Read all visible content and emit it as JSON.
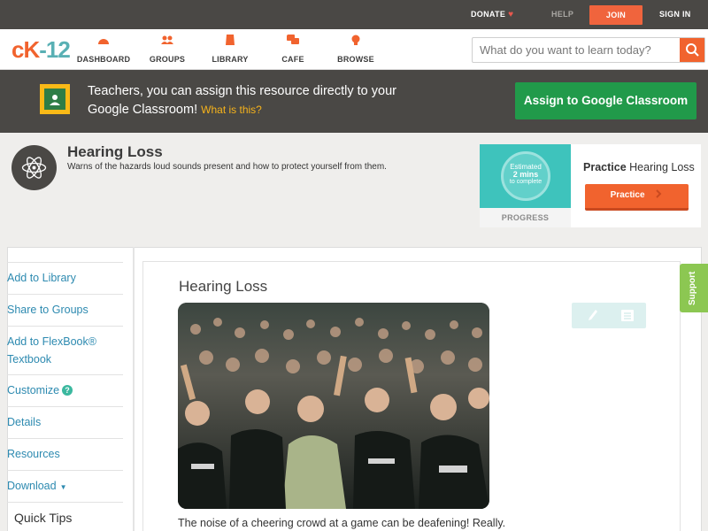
{
  "topbar": {
    "donate": "DONATE",
    "help": "HELP",
    "join": "JOIN",
    "signin": "SIGN IN"
  },
  "nav": {
    "logo": "CK-12",
    "items": [
      {
        "label": "DASHBOARD",
        "icon": "dashboard-icon"
      },
      {
        "label": "GROUPS",
        "icon": "groups-icon"
      },
      {
        "label": "LIBRARY",
        "icon": "library-icon"
      },
      {
        "label": "CAFE",
        "icon": "cafe-icon"
      },
      {
        "label": "BROWSE",
        "icon": "browse-icon"
      }
    ],
    "search_placeholder": "What do you want to learn today?"
  },
  "banner": {
    "text": "Teachers, you can assign this resource directly to your Google Classroom!",
    "link": "What is this?",
    "button": "Assign to Google Classroom"
  },
  "header": {
    "title": "Hearing Loss",
    "subtitle": "Warns of the hazards loud sounds present and how to protect yourself from them."
  },
  "practice": {
    "estimated": "Estimated",
    "mins": "2 mins",
    "to_complete": "to complete",
    "progress_label": "PROGRESS",
    "title_bold": "Practice",
    "title_rest": "Hearing Loss",
    "button": "Practice"
  },
  "sidebar": {
    "items": [
      {
        "label": "Add to Library"
      },
      {
        "label": "Share to Groups"
      },
      {
        "label": "Add to FlexBook® Textbook"
      },
      {
        "label": "Customize"
      },
      {
        "label": "Details"
      },
      {
        "label": "Resources"
      },
      {
        "label": "Download"
      }
    ],
    "quick_tips": "Quick Tips"
  },
  "article": {
    "title": "Hearing Loss",
    "intro": "The noise of a cheering crowd at a game can be deafening! Really."
  },
  "support": "Support",
  "colors": {
    "accent": "#f1632e",
    "dark": "#4a4845",
    "green": "#219a4a",
    "link": "#2d8ab0",
    "teal": "#3ec3bc"
  }
}
